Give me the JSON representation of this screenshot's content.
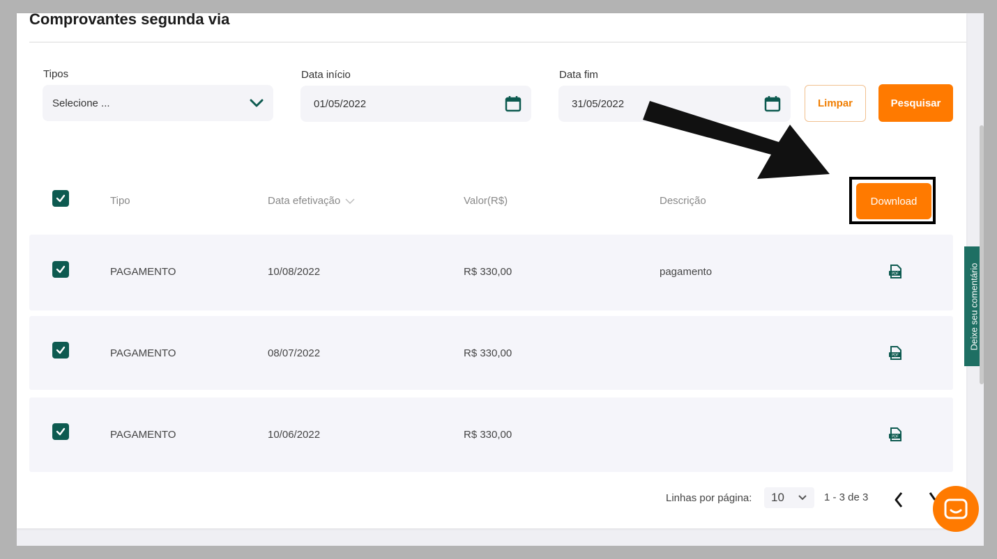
{
  "page": {
    "title": "Comprovantes segunda via"
  },
  "filters": {
    "tipos": {
      "label": "Tipos",
      "value": "Selecione ..."
    },
    "data_inicio": {
      "label": "Data início",
      "value": "01/05/2022"
    },
    "data_fim": {
      "label": "Data fim",
      "value": "31/05/2022"
    },
    "limpar_label": "Limpar",
    "pesquisar_label": "Pesquisar"
  },
  "table": {
    "headers": {
      "tipo": "Tipo",
      "data": "Data efetivação",
      "valor": "Valor(R$)",
      "descricao": "Descrição"
    },
    "download_label": "Download",
    "rows": [
      {
        "tipo": "PAGAMENTO",
        "data": "10/08/2022",
        "valor": "R$ 330,00",
        "descricao": "pagamento"
      },
      {
        "tipo": "PAGAMENTO",
        "data": "08/07/2022",
        "valor": "R$ 330,00",
        "descricao": ""
      },
      {
        "tipo": "PAGAMENTO",
        "data": "10/06/2022",
        "valor": "R$ 330,00",
        "descricao": ""
      }
    ]
  },
  "pagination": {
    "rows_label": "Linhas por página:",
    "rows_per_page": "10",
    "range": "1 - 3 de 3"
  },
  "side_tab": {
    "label": "Deixe seu comentário"
  },
  "colors": {
    "accent": "#ff7a00",
    "teal": "#0d5a50",
    "row_bg": "#f5f5fa"
  },
  "icons": [
    "chevron-down-icon",
    "calendar-icon",
    "check-icon",
    "sort-chevron-icon",
    "pdf-icon",
    "chevron-left-icon",
    "chevron-right-icon",
    "chat-icon",
    "arrow-annotation"
  ]
}
